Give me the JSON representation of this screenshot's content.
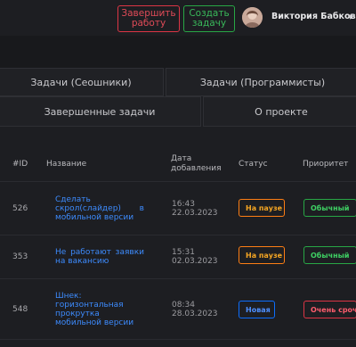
{
  "header": {
    "finish_button": "Завершить работу",
    "create_button": "Создать задачу",
    "user_name": "Виктория Бабкова"
  },
  "tabs": [
    {
      "label": "Задачи (Сеошники)"
    },
    {
      "label": "Задачи (Программисты)"
    },
    {
      "label": "Завершенные задачи"
    },
    {
      "label": "О проекте"
    }
  ],
  "table": {
    "columns": {
      "id": "#ID",
      "name": "Название",
      "date": "Дата добавления",
      "status": "Статус",
      "priority": "Приоритет"
    },
    "rows": [
      {
        "id": "526",
        "name": "Сделать скрол(слайдер) в мобильной версии",
        "time": "16:43",
        "date": "22.03.2023",
        "status": "На паузе",
        "priority": "Обычный"
      },
      {
        "id": "353",
        "name": "Не работают заявки на вакансию",
        "time": "15:31",
        "date": "02.03.2023",
        "status": "На паузе",
        "priority": "Обычный"
      },
      {
        "id": "548",
        "name": "Шнек: горизонтальная прокрутка мобильной версии",
        "time": "08:34",
        "date": "28.03.2023",
        "status": "Новая",
        "priority": "Очень срочно"
      }
    ]
  },
  "colors": {
    "background": "#1d1e22",
    "danger": "#dc3545",
    "success": "#28a745",
    "warning": "#fd7e14",
    "primary": "#0d6efd",
    "link": "#3d8bfd"
  },
  "icons": {
    "dropdown": "chevron-down-icon"
  }
}
